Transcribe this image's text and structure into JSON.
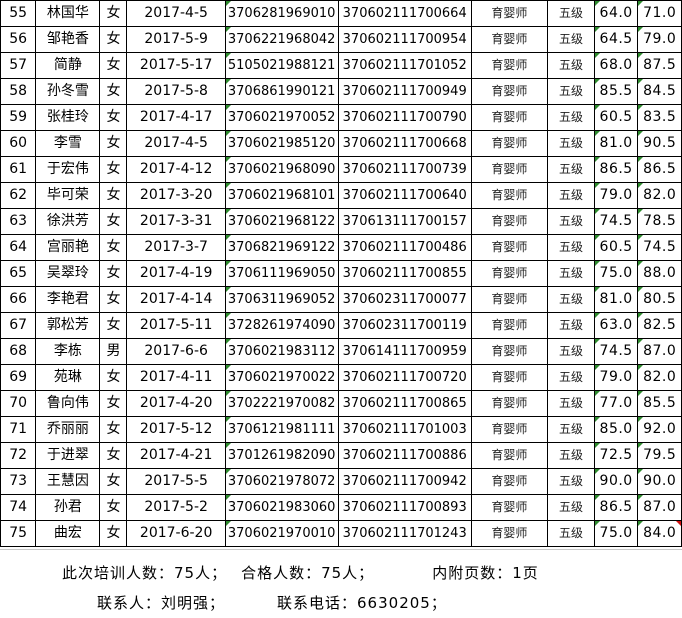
{
  "rows": [
    {
      "no": "55",
      "name": "林国华",
      "sex": "女",
      "date": "2017-4-5",
      "id": "3706281969010",
      "cert": "370602111700664",
      "job": "育婴师",
      "level": "五级",
      "s1": "64.0",
      "s2": "71.0"
    },
    {
      "no": "56",
      "name": "邹艳香",
      "sex": "女",
      "date": "2017-5-9",
      "id": "3706221968042",
      "cert": "370602111700954",
      "job": "育婴师",
      "level": "五级",
      "s1": "64.5",
      "s2": "79.0"
    },
    {
      "no": "57",
      "name": "简静",
      "sex": "女",
      "date": "2017-5-17",
      "id": "5105021988121",
      "cert": "370602111701052",
      "job": "育婴师",
      "level": "五级",
      "s1": "68.0",
      "s2": "87.5"
    },
    {
      "no": "58",
      "name": "孙冬雪",
      "sex": "女",
      "date": "2017-5-8",
      "id": "3706861990121",
      "cert": "370602111700949",
      "job": "育婴师",
      "level": "五级",
      "s1": "85.5",
      "s2": "84.5"
    },
    {
      "no": "59",
      "name": "张桂玲",
      "sex": "女",
      "date": "2017-4-17",
      "id": "3706021970052",
      "cert": "370602111700790",
      "job": "育婴师",
      "level": "五级",
      "s1": "60.5",
      "s2": "83.5"
    },
    {
      "no": "60",
      "name": "李雪",
      "sex": "女",
      "date": "2017-4-5",
      "id": "3706021985120",
      "cert": "370602111700668",
      "job": "育婴师",
      "level": "五级",
      "s1": "81.0",
      "s2": "90.5"
    },
    {
      "no": "61",
      "name": "于宏伟",
      "sex": "女",
      "date": "2017-4-12",
      "id": "3706021968090",
      "cert": "370602111700739",
      "job": "育婴师",
      "level": "五级",
      "s1": "86.5",
      "s2": "86.5"
    },
    {
      "no": "62",
      "name": "毕可荣",
      "sex": "女",
      "date": "2017-3-20",
      "id": "3706021968101",
      "cert": "370602111700640",
      "job": "育婴师",
      "level": "五级",
      "s1": "79.0",
      "s2": "82.0"
    },
    {
      "no": "63",
      "name": "徐洪芳",
      "sex": "女",
      "date": "2017-3-31",
      "id": "3706021968122",
      "cert": "370613111700157",
      "job": "育婴师",
      "level": "五级",
      "s1": "74.5",
      "s2": "78.5"
    },
    {
      "no": "64",
      "name": "宫丽艳",
      "sex": "女",
      "date": "2017-3-7",
      "id": "3706821969122",
      "cert": "370602111700486",
      "job": "育婴师",
      "level": "五级",
      "s1": "60.5",
      "s2": "74.5"
    },
    {
      "no": "65",
      "name": "吴翠玲",
      "sex": "女",
      "date": "2017-4-19",
      "id": "3706111969050",
      "cert": "370602111700855",
      "job": "育婴师",
      "level": "五级",
      "s1": "75.0",
      "s2": "88.0"
    },
    {
      "no": "66",
      "name": "李艳君",
      "sex": "女",
      "date": "2017-4-14",
      "id": "3706311969052",
      "cert": "370602311700077",
      "job": "育婴师",
      "level": "五级",
      "s1": "81.0",
      "s2": "80.5"
    },
    {
      "no": "67",
      "name": "郭松芳",
      "sex": "女",
      "date": "2017-5-11",
      "id": "3728261974090",
      "cert": "370602311700119",
      "job": "育婴师",
      "level": "五级",
      "s1": "63.0",
      "s2": "82.5"
    },
    {
      "no": "68",
      "name": "李栋",
      "sex": "男",
      "date": "2017-6-6",
      "id": "3706021983112",
      "cert": "370614111700959",
      "job": "育婴师",
      "level": "五级",
      "s1": "74.5",
      "s2": "87.0"
    },
    {
      "no": "69",
      "name": "苑琳",
      "sex": "女",
      "date": "2017-4-11",
      "id": "3706021970022",
      "cert": "370602111700720",
      "job": "育婴师",
      "level": "五级",
      "s1": "79.0",
      "s2": "82.0"
    },
    {
      "no": "70",
      "name": "鲁向伟",
      "sex": "女",
      "date": "2017-4-20",
      "id": "3702221970082",
      "cert": "370602111700865",
      "job": "育婴师",
      "level": "五级",
      "s1": "77.0",
      "s2": "85.5"
    },
    {
      "no": "71",
      "name": "乔丽丽",
      "sex": "女",
      "date": "2017-5-12",
      "id": "3706121981111",
      "cert": "370602111701003",
      "job": "育婴师",
      "level": "五级",
      "s1": "85.0",
      "s2": "92.0"
    },
    {
      "no": "72",
      "name": "于进翠",
      "sex": "女",
      "date": "2017-4-21",
      "id": "3701261982090",
      "cert": "370602111700886",
      "job": "育婴师",
      "level": "五级",
      "s1": "72.5",
      "s2": "79.5"
    },
    {
      "no": "73",
      "name": "王慧因",
      "sex": "女",
      "date": "2017-5-5",
      "id": "3706021978072",
      "cert": "370602111700942",
      "job": "育婴师",
      "level": "五级",
      "s1": "90.0",
      "s2": "90.0"
    },
    {
      "no": "74",
      "name": "孙君",
      "sex": "女",
      "date": "2017-5-2",
      "id": "3706021983060",
      "cert": "370602111700893",
      "job": "育婴师",
      "level": "五级",
      "s1": "86.5",
      "s2": "87.0"
    },
    {
      "no": "75",
      "name": "曲宏",
      "sex": "女",
      "date": "2017-6-20",
      "id": "3706021970010",
      "cert": "370602111701243",
      "job": "育婴师",
      "level": "五级",
      "s1": "75.0",
      "s2": "84.0"
    }
  ],
  "summary": {
    "trained": "此次培训人数：75人；",
    "passed": "合格人数：75人；",
    "pages": "内附页数：1页",
    "contact": "联系人：刘明强；",
    "phone": "联系电话：6630205；"
  },
  "colors": {
    "cell_marker": "#2e8b2e",
    "error_marker": "#d01010",
    "grid": "#000000"
  }
}
